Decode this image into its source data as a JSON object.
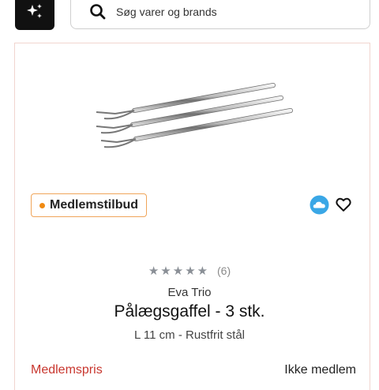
{
  "header": {
    "search_placeholder": "Søg varer og brands",
    "sparkle_icon": "sparkle-icon",
    "search_icon": "search-icon"
  },
  "product": {
    "badge": "Medlemstilbud",
    "rating": 5,
    "review_count": "(6)",
    "brand": "Eva Trio",
    "title": "Pålægsgaffel - 3 stk.",
    "description": "L 11 cm - Rustfrit stål",
    "member_price_label": "Medlemspris",
    "non_member_label": "Ikke medlem"
  },
  "colors": {
    "badge_border": "#f0a55a",
    "badge_dot": "#f08a12",
    "member_price": "#c8362e",
    "cloud_badge": "#3aa7e6"
  }
}
